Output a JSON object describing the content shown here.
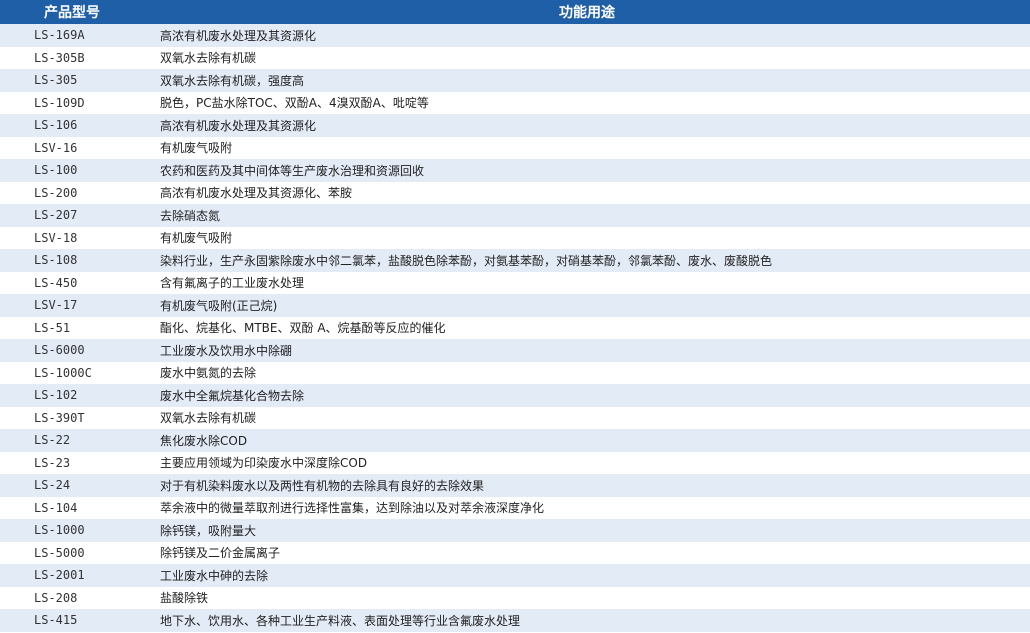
{
  "table": {
    "headers": [
      "产品型号",
      "功能用途"
    ],
    "rows": [
      {
        "model": "LS-169A",
        "use": "高浓有机废水处理及其资源化"
      },
      {
        "model": "LS-305B",
        "use": "双氧水去除有机碳"
      },
      {
        "model": "LS-305",
        "use": "双氧水去除有机碳，强度高"
      },
      {
        "model": "LS-109D",
        "use": "脱色，PC盐水除TOC、双酚A、4溴双酚A、吡啶等"
      },
      {
        "model": "LS-106",
        "use": "高浓有机废水处理及其资源化"
      },
      {
        "model": "LSV-16",
        "use": "有机废气吸附"
      },
      {
        "model": "LS-100",
        "use": "农药和医药及其中间体等生产废水治理和资源回收"
      },
      {
        "model": "LS-200",
        "use": "高浓有机废水处理及其资源化、苯胺"
      },
      {
        "model": "LS-207",
        "use": "去除硝态氮"
      },
      {
        "model": "LSV-18",
        "use": "有机废气吸附"
      },
      {
        "model": "LS-108",
        "use": "染料行业，生产永固紫除废水中邻二氯苯，盐酸脱色除苯酚，对氨基苯酚，对硝基苯酚，邻氯苯酚、废水、废酸脱色"
      },
      {
        "model": "LS-450",
        "use": "含有氟离子的工业废水处理"
      },
      {
        "model": "LSV-17",
        "use": "有机废气吸附(正己烷)"
      },
      {
        "model": "LS-51",
        "use": "酯化、烷基化、MTBE、双酚 A、烷基酚等反应的催化"
      },
      {
        "model": "LS-6000",
        "use": "工业废水及饮用水中除硼"
      },
      {
        "model": "LS-1000C",
        "use": "废水中氨氮的去除"
      },
      {
        "model": "LS-102",
        "use": "废水中全氟烷基化合物去除"
      },
      {
        "model": "LS-390T",
        "use": "双氧水去除有机碳"
      },
      {
        "model": "LS-22",
        "use": "焦化废水除COD"
      },
      {
        "model": "LS-23",
        "use": "主要应用领域为印染废水中深度除COD"
      },
      {
        "model": "LS-24",
        "use": "对于有机染料废水以及两性有机物的去除具有良好的去除效果"
      },
      {
        "model": "LS-104",
        "use": "萃余液中的微量萃取剂进行选择性富集，达到除油以及对萃余液深度净化"
      },
      {
        "model": "LS-1000",
        "use": "除钙镁，吸附量大"
      },
      {
        "model": "LS-5000",
        "use": "除钙镁及二价金属离子"
      },
      {
        "model": "LS-2001",
        "use": "工业废水中砷的去除"
      },
      {
        "model": "LS-208",
        "use": "盐酸除铁"
      },
      {
        "model": "LS-415",
        "use": "地下水、饮用水、各种工业生产料液、表面处理等行业含氟废水处理"
      }
    ]
  }
}
